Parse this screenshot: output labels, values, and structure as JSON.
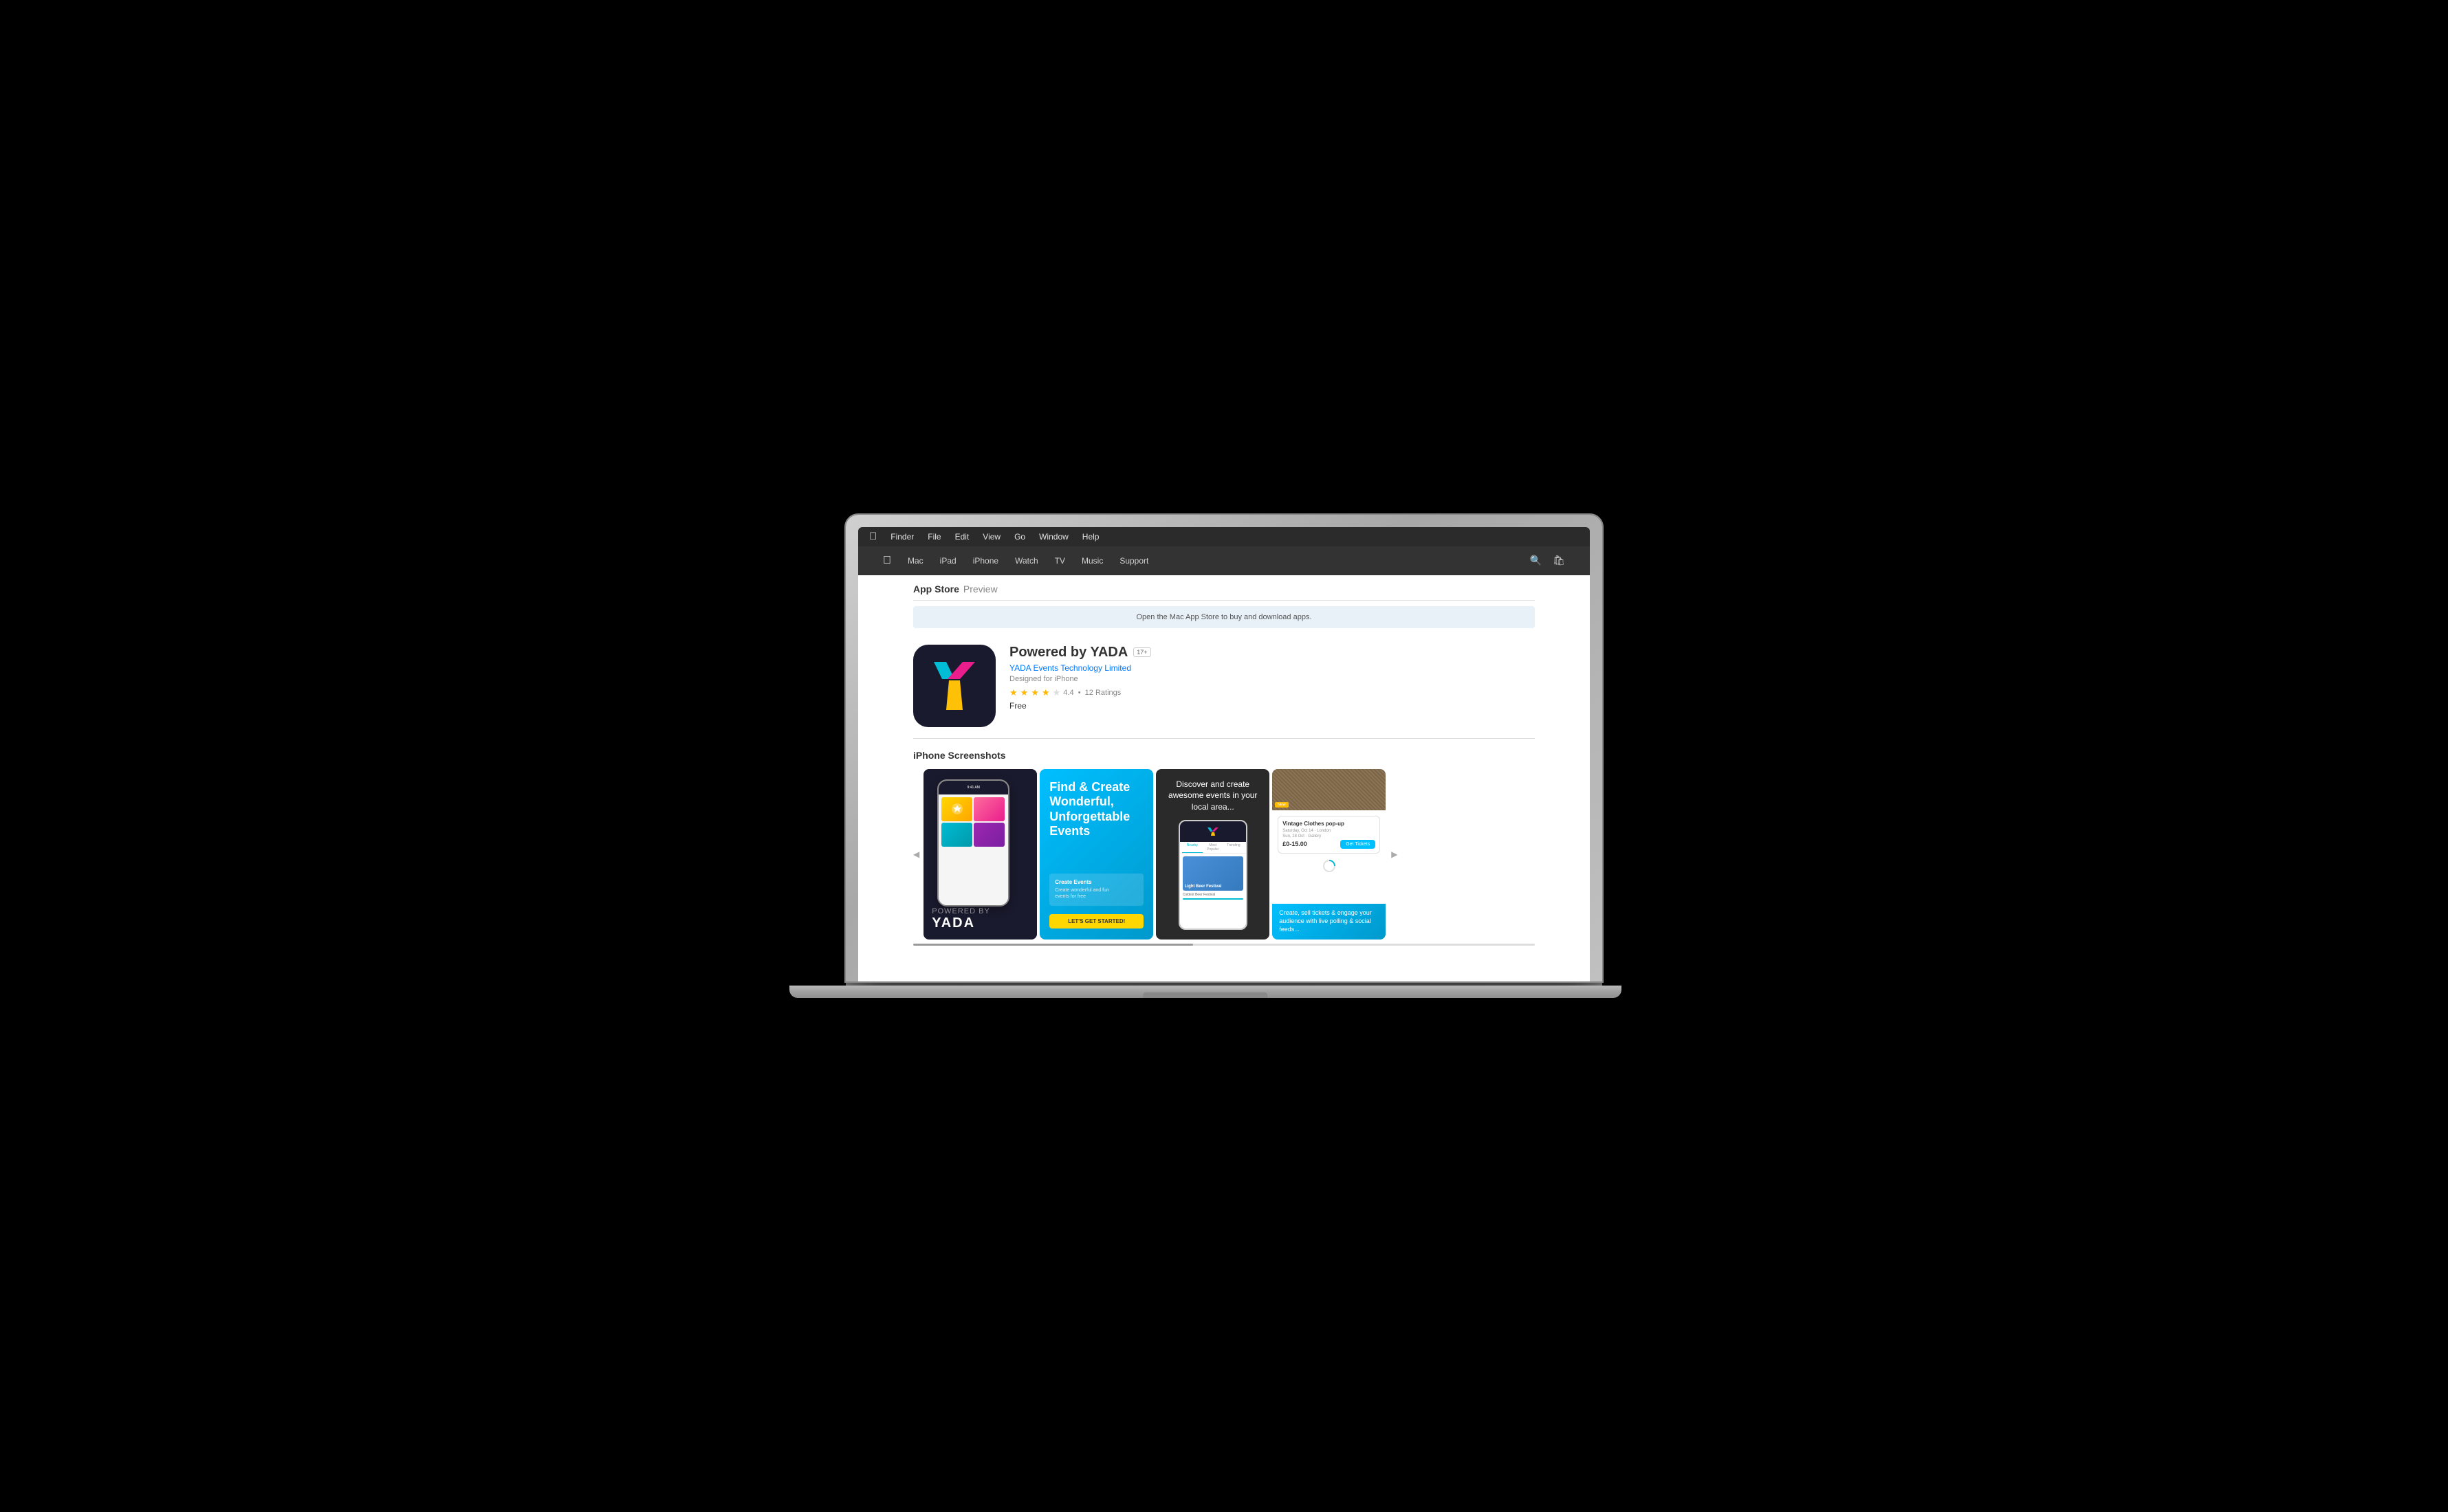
{
  "laptop": {
    "screen_bg": "#000"
  },
  "menubar": {
    "apple": "&#63743;",
    "items": [
      "Finder",
      "File",
      "Edit",
      "View",
      "Go",
      "Window",
      "Help"
    ]
  },
  "nav": {
    "apple_logo": "&#63743;",
    "items": [
      "Mac",
      "iPad",
      "iPhone",
      "Watch",
      "TV",
      "Music",
      "Support"
    ],
    "search_icon": "&#128269;",
    "bag_icon": "&#128717;"
  },
  "appstore": {
    "header_title": "App Store",
    "header_sub": "Preview",
    "banner": "Open the Mac App Store to buy and download apps.",
    "app": {
      "name": "Powered by YADA",
      "age_rating": "17+",
      "developer": "YADA Events Technology Limited",
      "designed_for": "Designed for iPhone",
      "rating_value": "4.4",
      "rating_count": "12 Ratings",
      "price": "Free"
    },
    "screenshots_title": "iPhone Screenshots",
    "screenshots": [
      {
        "id": "ss1",
        "alt": "YADA app home screen with phone mockup"
      },
      {
        "id": "ss2",
        "title": "Find & Create Wonderful, Unforgettable Events",
        "sub": "Create Events\nCreate wonderful and fun\nevents for free",
        "btn": "LET'S GET STARTED!"
      },
      {
        "id": "ss3",
        "text": "Discover and create awesome events in your local area...",
        "event_name": "Light Beer Festival"
      },
      {
        "id": "ss4",
        "card_title": "Vintage Clothes pop-up",
        "price": "£0-15.00",
        "btn_label": "Get Tickets",
        "bottom_text": "Create, sell tickets & engage your audience with live polling & social feeds..."
      }
    ]
  }
}
